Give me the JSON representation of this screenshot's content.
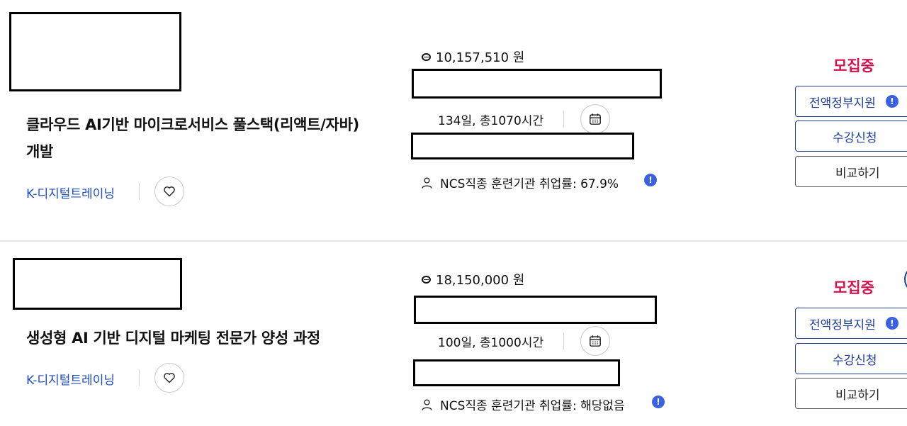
{
  "courses": [
    {
      "title": "클라우드 AI기반 마이크로서비스 풀스택(리액트/자바) 개발",
      "org": "K-디지털트레이닝",
      "price": "10,157,510 원",
      "duration": "134일, 총1070시간",
      "ncs": "NCS직종 훈련기관 취업률: 67.9%",
      "status": "모집중",
      "support_label": "전액정부지원",
      "apply_label": "수강신청",
      "compare_label": "비교하기"
    },
    {
      "title": "생성형 AI 기반 디지털 마케팅 전문가 양성 과정",
      "org": "K-디지털트레이닝",
      "price": "18,150,000 원",
      "duration": "100일, 총1000시간",
      "ncs": "NCS직종 훈련기관 취업률: 해당없음",
      "status": "모집중",
      "support_label": "전액정부지원",
      "apply_label": "수강신청",
      "compare_label": "비교하기"
    }
  ],
  "info_glyph": "!",
  "colors": {
    "accent_blue": "#1f3f9a",
    "status_red": "#d3124e",
    "org_blue": "#1f4fbf",
    "info_blue": "#3a62e0"
  }
}
